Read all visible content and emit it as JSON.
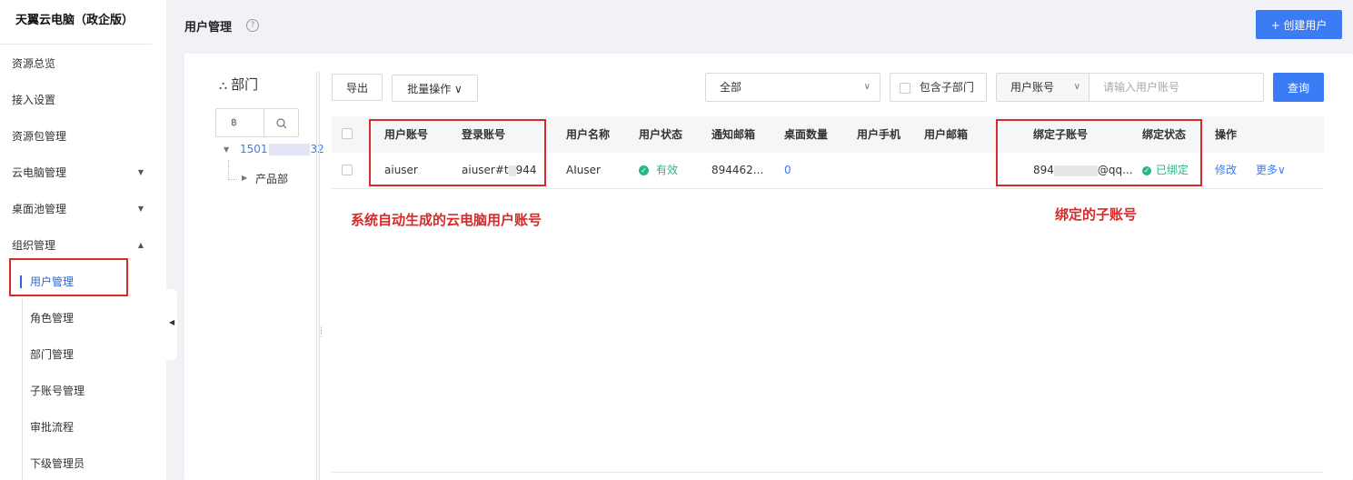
{
  "app": {
    "title": "天翼云电脑（政企版）"
  },
  "sidebar": {
    "items": [
      {
        "label": "资源总览"
      },
      {
        "label": "接入设置"
      },
      {
        "label": "资源包管理"
      },
      {
        "label": "云电脑管理",
        "expand": "▼"
      },
      {
        "label": "桌面池管理",
        "expand": "▼"
      },
      {
        "label": "组织管理",
        "expand": "▲"
      }
    ],
    "subitems": [
      {
        "label": "用户管理",
        "active": true
      },
      {
        "label": "角色管理"
      },
      {
        "label": "部门管理"
      },
      {
        "label": "子账号管理"
      },
      {
        "label": "审批流程"
      },
      {
        "label": "下级管理员"
      }
    ]
  },
  "header": {
    "title": "用户管理",
    "help_icon": "?",
    "create_button": "+ 创建用户"
  },
  "dept": {
    "title": "部门",
    "search_value": "฿",
    "tree_root_prefix": "1501",
    "tree_root_suffix": "32",
    "tree_child": "产品部"
  },
  "toolbar": {
    "export_label": "导出",
    "batch_label": "批量操作 ∨",
    "filter_value": "全部",
    "include_sub_label": "包含子部门",
    "account_type": "用户账号",
    "search_placeholder": "请输入用户账号",
    "query_label": "查询"
  },
  "table": {
    "columns": [
      "用户账号",
      "登录账号",
      "用户名称",
      "用户状态",
      "通知邮箱",
      "桌面数量",
      "用户手机",
      "用户邮箱",
      "绑定子账号",
      "绑定状态",
      "操作"
    ],
    "rows": [
      {
        "user_account": "aiuser",
        "login_account_prefix": "aiuser#t",
        "login_account_suffix": "944",
        "user_name": "AIuser",
        "status": "有效",
        "notify_email": "894462...",
        "desktop_count": "0",
        "phone": "",
        "email": "",
        "sub_account_prefix": "894",
        "sub_account_suffix": "@qq...",
        "bind_status": "已绑定",
        "action_edit": "修改",
        "action_more": "更多∨"
      }
    ]
  },
  "annotations": {
    "left_note": "系统自动生成的云电脑用户账号",
    "right_note": "绑定的子账号"
  },
  "colors": {
    "accent": "#3b7cf5",
    "status_green": "#28b780",
    "annotation_red": "#d72a2a"
  }
}
